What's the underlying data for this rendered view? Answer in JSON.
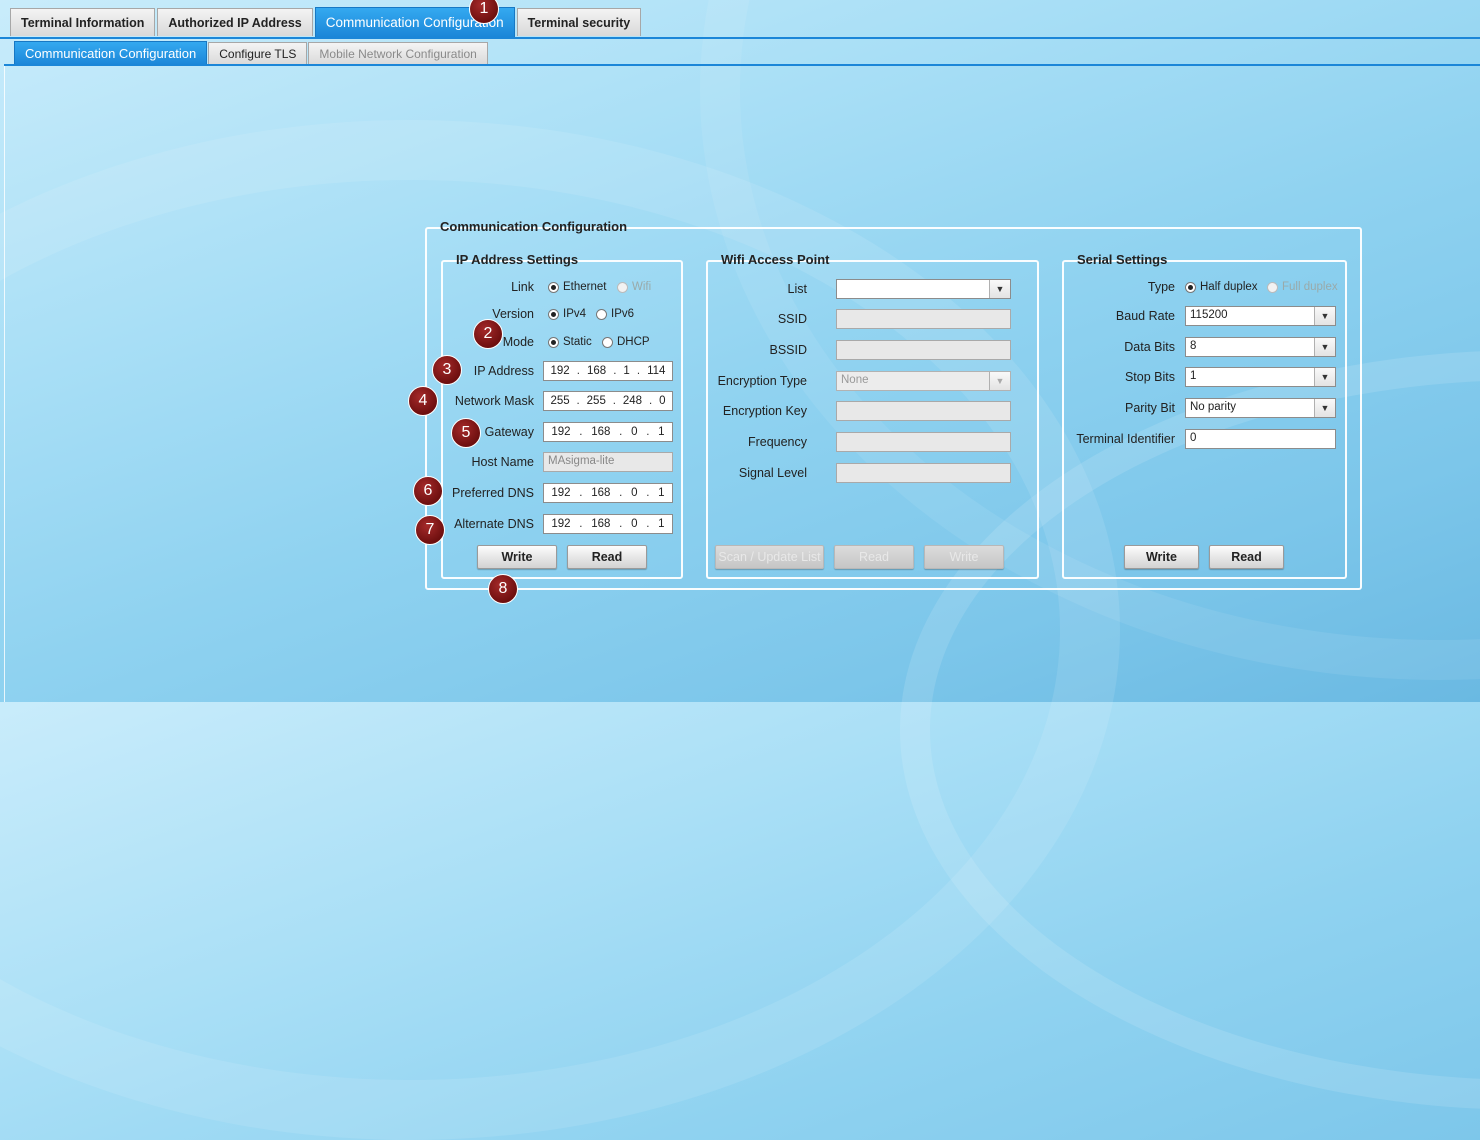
{
  "top_tabs": [
    "Terminal Information",
    "Authorized IP Address",
    "Communication Configuration",
    "Terminal security"
  ],
  "sub_tabs": [
    "Communication Configuration",
    "Configure TLS",
    "Mobile Network Configuration"
  ],
  "outer_group": "Communication Configuration",
  "ip_settings": {
    "title": "IP Address Settings",
    "link_label": "Link",
    "link_options": [
      "Ethernet",
      "Wifi"
    ],
    "version_label": "Version",
    "version_options": [
      "IPv4",
      "IPv6"
    ],
    "mode_label": "Mode",
    "mode_options": [
      "Static",
      "DHCP"
    ],
    "ip_label": "IP Address",
    "ip": [
      "192",
      "168",
      "1",
      "114"
    ],
    "mask_label": "Network Mask",
    "mask": [
      "255",
      "255",
      "248",
      "0"
    ],
    "gateway_label": "Gateway",
    "gateway": [
      "192",
      "168",
      "0",
      "1"
    ],
    "host_label": "Host Name",
    "host_value": "MAsigma-lite",
    "pdns_label": "Preferred DNS",
    "pdns": [
      "192",
      "168",
      "0",
      "1"
    ],
    "adns_label": "Alternate DNS",
    "adns": [
      "192",
      "168",
      "0",
      "1"
    ],
    "write": "Write",
    "read": "Read"
  },
  "wifi": {
    "title": "Wifi Access Point",
    "list_label": "List",
    "ssid_label": "SSID",
    "bssid_label": "BSSID",
    "enc_type_label": "Encryption Type",
    "enc_type_value": "None",
    "enc_key_label": "Encryption Key",
    "freq_label": "Frequency",
    "signal_label": "Signal Level",
    "scan": "Scan / Update List",
    "read": "Read",
    "write": "Write"
  },
  "serial": {
    "title": "Serial Settings",
    "type_label": "Type",
    "type_options": [
      "Half duplex",
      "Full duplex"
    ],
    "baud_label": "Baud Rate",
    "baud_value": "115200",
    "databits_label": "Data Bits",
    "databits_value": "8",
    "stopbits_label": "Stop Bits",
    "stopbits_value": "1",
    "parity_label": "Parity Bit",
    "parity_value": "No parity",
    "termid_label": "Terminal Identifier",
    "termid_value": "0",
    "write": "Write",
    "read": "Read"
  },
  "markers": [
    "1",
    "2",
    "3",
    "4",
    "5",
    "6",
    "7",
    "8"
  ],
  "colors": {
    "accent": "#1b86d8",
    "marker": "#8b1a1a"
  }
}
